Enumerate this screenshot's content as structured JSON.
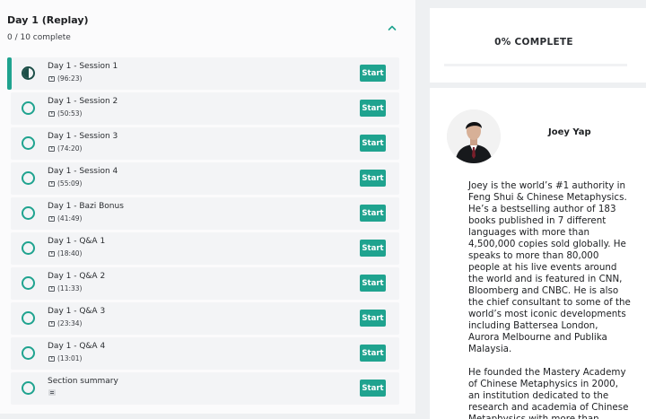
{
  "section": {
    "title": "Day 1 (Replay)",
    "progress": "0 / 10 complete"
  },
  "lessons": [
    {
      "title": "Day 1 - Session 1",
      "meta": "(96:23)",
      "type": "video",
      "status": "in-progress",
      "button": "Start"
    },
    {
      "title": "Day 1 - Session 2",
      "meta": "(50:53)",
      "type": "video",
      "status": "not-started",
      "button": "Start"
    },
    {
      "title": "Day 1 - Session 3",
      "meta": "(74:20)",
      "type": "video",
      "status": "not-started",
      "button": "Start"
    },
    {
      "title": "Day 1 - Session 4",
      "meta": "(55:09)",
      "type": "video",
      "status": "not-started",
      "button": "Start"
    },
    {
      "title": "Day 1 - Bazi Bonus",
      "meta": "(41:49)",
      "type": "video",
      "status": "not-started",
      "button": "Start"
    },
    {
      "title": "Day 1 - Q&A 1",
      "meta": "(18:40)",
      "type": "video",
      "status": "not-started",
      "button": "Start"
    },
    {
      "title": "Day 1 - Q&A 2",
      "meta": "(11:33)",
      "type": "video",
      "status": "not-started",
      "button": "Start"
    },
    {
      "title": "Day 1 - Q&A 3",
      "meta": "(23:34)",
      "type": "video",
      "status": "not-started",
      "button": "Start"
    },
    {
      "title": "Day 1 - Q&A 4",
      "meta": "(13:01)",
      "type": "video",
      "status": "not-started",
      "button": "Start"
    },
    {
      "title": "Section summary",
      "meta": "",
      "type": "text",
      "status": "not-started",
      "button": "Start"
    }
  ],
  "progress_card": {
    "label": "0% COMPLETE",
    "percent": 0
  },
  "author": {
    "name": "Joey Yap",
    "bio": [
      "Joey is the world’s #1 authority in Feng Shui & Chinese Metaphysics. He’s a bestselling author of 183 books published in 7 different languages with more than 4,500,000 copies sold globally. He speaks to more than 80,000 people at his live events around the world and is featured in CNN, Bloomberg and CNBC. He is also the chief consultant to some of the world’s most iconic developments including Battersea London, Aurora Melbourne and Publika Malaysia.",
      "He founded the Mastery Academy of Chinese Metaphysics in 2000, an institution dedicated to the research and academia of Chinese Metaphysics with more than"
    ]
  },
  "colors": {
    "accent": "#1fa38f",
    "in_progress": "#1d4f48"
  }
}
